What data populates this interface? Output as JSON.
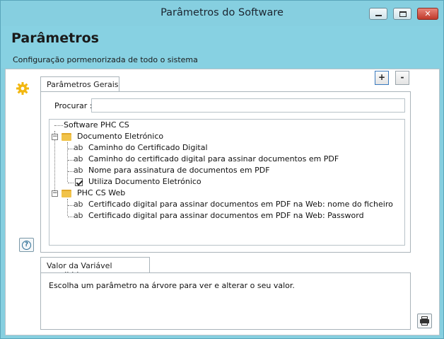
{
  "window": {
    "title": "Parâmetros do Software",
    "controls": {
      "minimize": "minimize",
      "maximize": "maximize",
      "close": "✕"
    }
  },
  "header": {
    "title": "Parâmetros",
    "subtitle": "Configuração pormenorizada de todo o sistema"
  },
  "toolbar": {
    "expand_label": "+",
    "collapse_label": "-",
    "help_label": "?"
  },
  "tabs": {
    "general": "Parâmetros Gerais",
    "value": "Valor da Variável escolhida"
  },
  "search": {
    "label": "Procurar :",
    "value": "",
    "placeholder": ""
  },
  "tree": {
    "root": "Software PHC CS",
    "groups": [
      {
        "label": "Documento Eletrónico",
        "expanded": true,
        "items": [
          {
            "type": "text",
            "label": "Caminho do Certificado Digital"
          },
          {
            "type": "text",
            "label": "Caminho do certificado digital para assinar documentos em PDF"
          },
          {
            "type": "text",
            "label": "Nome para assinatura de documentos em PDF"
          },
          {
            "type": "boolean",
            "label": "Utiliza Documento Eletrónico"
          }
        ]
      },
      {
        "label": "PHC CS Web",
        "expanded": true,
        "items": [
          {
            "type": "text",
            "label": "Certificado digital para assinar documentos em PDF na Web: nome do ficheiro"
          },
          {
            "type": "text",
            "label": "Certificado digital para assinar documentos em PDF na Web: Password"
          }
        ]
      }
    ],
    "text_icon": "ab",
    "expander_glyph": "−"
  },
  "value_panel": {
    "text": "Escolha um parâmetro na árvore para ver e alterar o seu valor."
  },
  "icons": {
    "settings": "gear-icon",
    "help": "help-icon",
    "print": "printer-icon",
    "folder": "folder-icon",
    "check": "checkbox-icon"
  },
  "colors": {
    "titlebar": "#86cfe0",
    "header": "#87d1e2",
    "accent_gear": "#f2b70f"
  }
}
